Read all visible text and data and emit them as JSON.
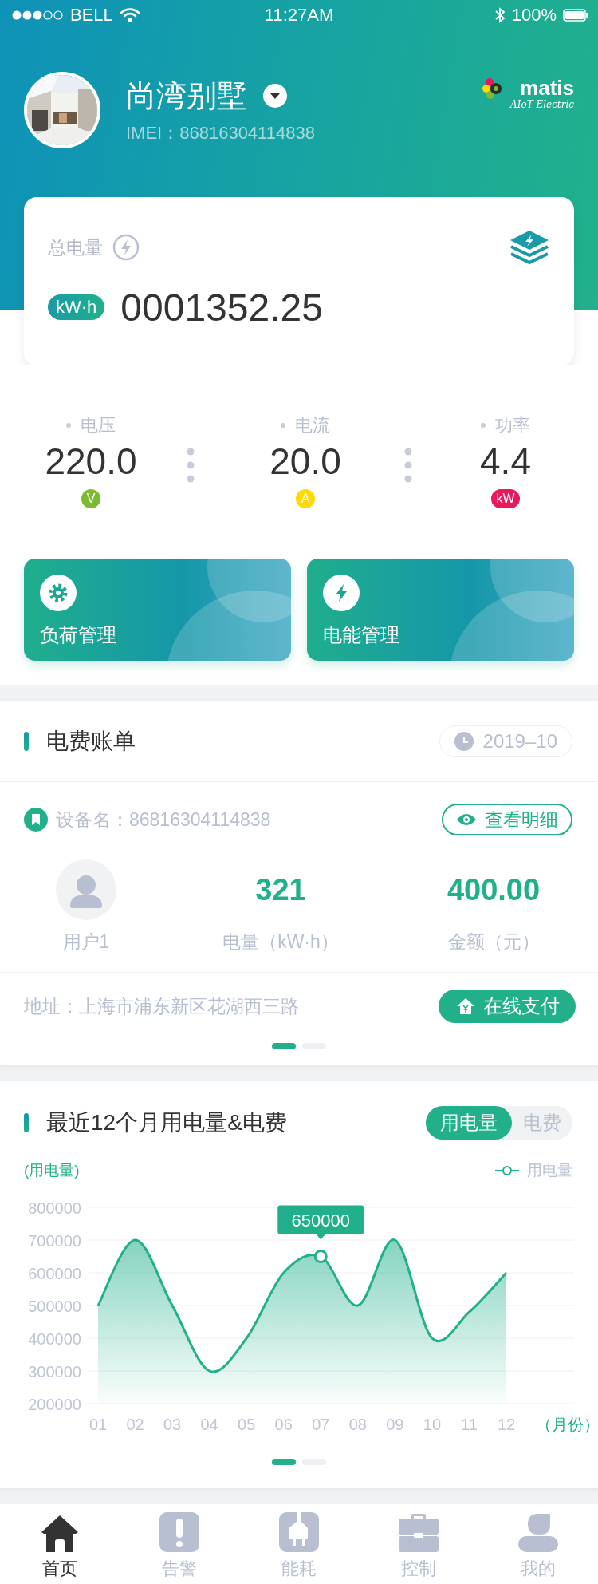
{
  "status_bar": {
    "carrier": "BELL",
    "time": "11:27AM",
    "battery": "100%"
  },
  "header": {
    "title": "尚湾别墅",
    "imei": "IMEI：86816304114838",
    "logo": {
      "name": "matis",
      "tagline": "AIoT Electric"
    }
  },
  "total_card": {
    "label": "总电量",
    "unit": "kW·h",
    "value": "0001352.25"
  },
  "readings": [
    {
      "label": "电压",
      "value": "220.0",
      "unit": "V",
      "color": "#7cbb2f"
    },
    {
      "label": "电流",
      "value": "20.0",
      "unit": "A",
      "color": "#ffd900"
    },
    {
      "label": "功率",
      "value": "4.4",
      "unit": "kW",
      "color": "#e8185a"
    }
  ],
  "shortcuts": [
    {
      "label": "负荷管理",
      "kind": "gear"
    },
    {
      "label": "电能管理",
      "kind": "bolt"
    }
  ],
  "bill": {
    "title": "电费账单",
    "date": "2019–10",
    "device": "设备名：86816304114838",
    "detail_button": "查看明细",
    "user": "用户1",
    "energy": {
      "value": "321",
      "label": "电量（kW·h）"
    },
    "amount": {
      "value": "400.00",
      "label": "金额（元）"
    },
    "address": "地址：上海市浦东新区花湖西三路",
    "pay_button": "在线支付",
    "pages": [
      {
        "selected": true
      },
      {
        "selected": false
      }
    ]
  },
  "usage": {
    "title": "最近12个月用电量&电费",
    "toggle": [
      {
        "label": "用电量",
        "selected": true
      },
      {
        "label": "电费",
        "selected": false
      }
    ],
    "chart_data": {
      "type": "area",
      "ylabel": "(用电量)",
      "xlabel": "（月份）",
      "categories": [
        "01",
        "02",
        "03",
        "04",
        "05",
        "06",
        "07",
        "08",
        "09",
        "10",
        "11",
        "12"
      ],
      "series": [
        {
          "name": "用电量",
          "color": "#21b08a",
          "values": [
            500000,
            700000,
            500000,
            300000,
            400000,
            600000,
            650000,
            500000,
            700000,
            400000,
            480000,
            600000
          ]
        }
      ],
      "ylim": [
        200000,
        800000
      ],
      "yticks": [
        200000,
        300000,
        400000,
        500000,
        600000,
        700000,
        800000
      ],
      "grid": true,
      "annotations": [
        {
          "x": "07",
          "y": 650000,
          "text": "650000"
        }
      ]
    },
    "pages": [
      {
        "selected": true
      },
      {
        "selected": false
      }
    ]
  },
  "tab_bar": [
    {
      "label": "首页",
      "kind": "home",
      "selected": true
    },
    {
      "label": "告警",
      "kind": "alert",
      "selected": false
    },
    {
      "label": "能耗",
      "kind": "plug",
      "selected": false
    },
    {
      "label": "控制",
      "kind": "case",
      "selected": false
    },
    {
      "label": "我的",
      "kind": "person",
      "selected": false
    }
  ]
}
